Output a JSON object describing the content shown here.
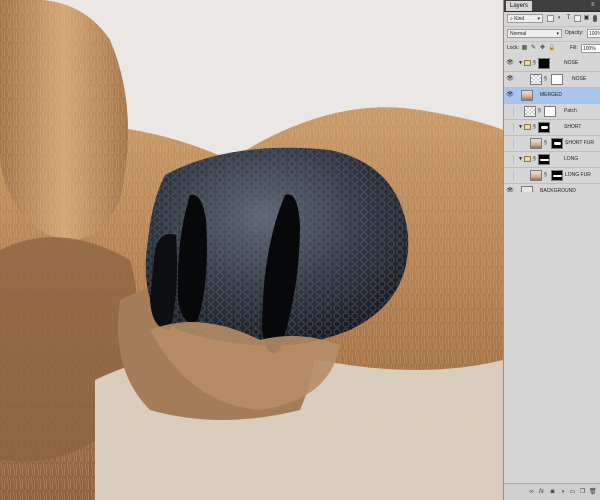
{
  "panel": {
    "tab_label": "Layers",
    "menu_icon": "panel-menu-icon",
    "filter": {
      "kind_label": "Kind"
    },
    "blend": {
      "mode": "Normal",
      "opacity_label": "Opacity:",
      "opacity_value": "100%"
    },
    "lock": {
      "label": "Lock:",
      "fill_label": "Fill:",
      "fill_value": "100%"
    }
  },
  "layers": [
    {
      "name": "NOSE",
      "type": "group",
      "visible": true
    },
    {
      "name": "NOSE",
      "type": "layer",
      "visible": true
    },
    {
      "name": "MERGED",
      "type": "layer",
      "visible": true,
      "selected": true
    },
    {
      "name": "Patch",
      "type": "layer",
      "visible": false
    },
    {
      "name": "SHORT",
      "type": "group",
      "visible": false
    },
    {
      "name": "SHORT FUR",
      "type": "layer",
      "visible": false
    },
    {
      "name": "LONG",
      "type": "group",
      "visible": false
    },
    {
      "name": "LONG FUR",
      "type": "layer",
      "visible": false
    },
    {
      "name": "BACKGROUND",
      "type": "background",
      "visible": true
    }
  ],
  "bottom_icons": [
    "link-layers-icon",
    "fx-icon",
    "add-mask-icon",
    "adjustment-layer-icon",
    "new-group-icon",
    "new-layer-icon",
    "delete-layer-icon"
  ],
  "colors": {
    "selection": "#a9c5ee",
    "panel_bg": "#d6d6d6"
  }
}
